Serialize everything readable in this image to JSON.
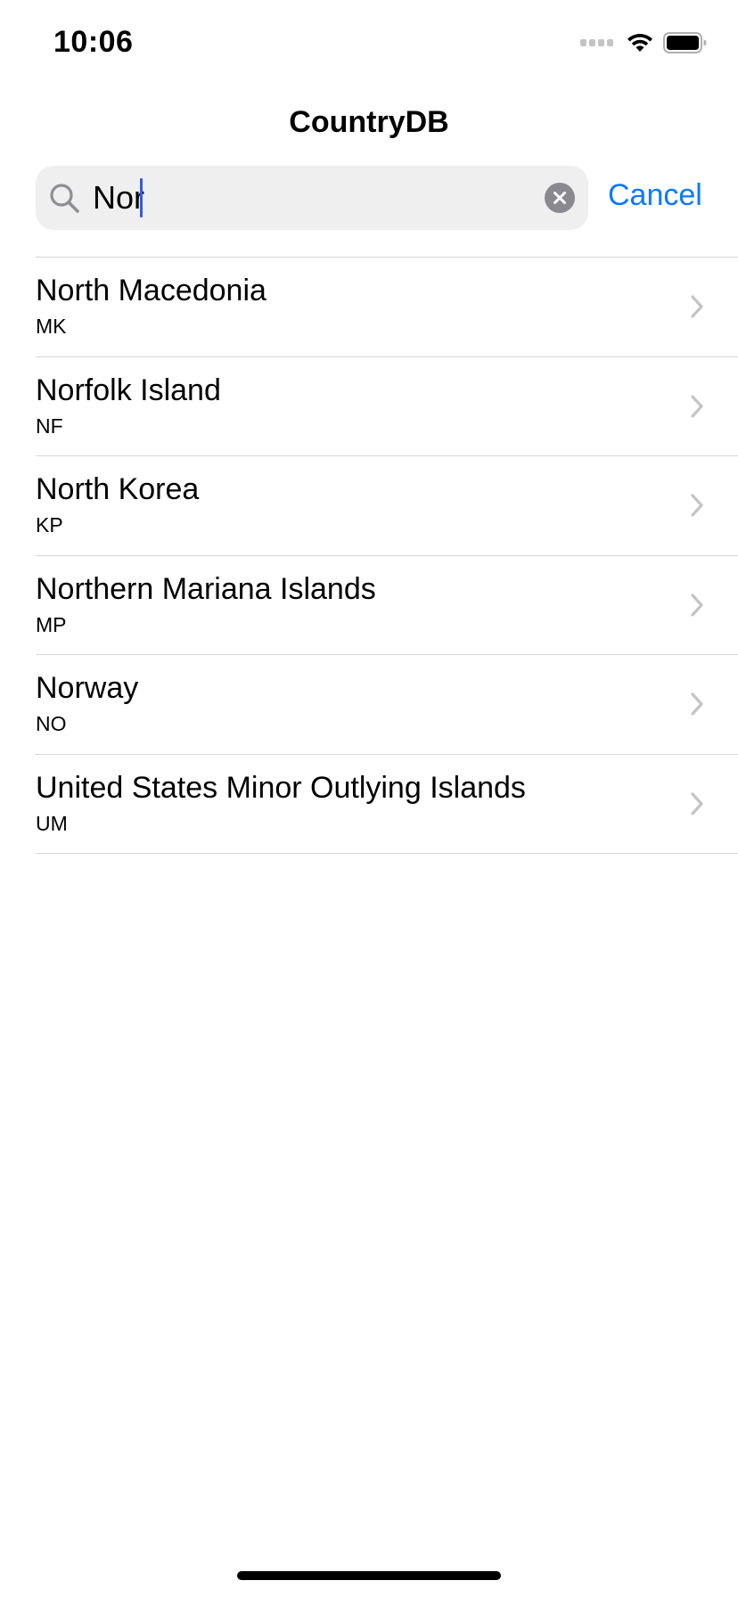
{
  "status_bar": {
    "time": "10:06"
  },
  "nav": {
    "title": "CountryDB"
  },
  "search": {
    "value": "Nor",
    "cancel_label": "Cancel"
  },
  "results": [
    {
      "name": "North Macedonia",
      "code": "MK"
    },
    {
      "name": "Norfolk Island",
      "code": "NF"
    },
    {
      "name": "North Korea",
      "code": "KP"
    },
    {
      "name": "Northern Mariana Islands",
      "code": "MP"
    },
    {
      "name": "Norway",
      "code": "NO"
    },
    {
      "name": "United States Minor Outlying Islands",
      "code": "UM"
    }
  ],
  "icons": {
    "search": "magnifying-glass",
    "clear": "x-circle-fill",
    "chevron": "chevron-right",
    "wifi": "wifi",
    "battery": "battery-full",
    "signal": "cellular-signal"
  },
  "colors": {
    "accent": "#0a7aff",
    "caret": "#3a5bd9",
    "search_field_bg": "#efeff0",
    "separator": "#d6d6d8",
    "chevron": "#c4c4c7"
  }
}
